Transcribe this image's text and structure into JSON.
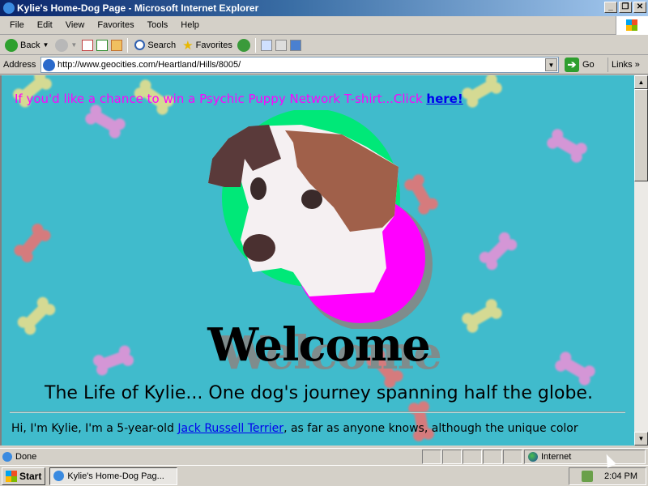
{
  "window": {
    "title": "Kylie's Home-Dog Page - Microsoft Internet Explorer",
    "buttons": [
      "_",
      "❐",
      "✕"
    ]
  },
  "menu": [
    "File",
    "Edit",
    "View",
    "Favorites",
    "Tools",
    "Help"
  ],
  "toolbar": {
    "back": "Back",
    "search": "Search",
    "favorites": "Favorites"
  },
  "address": {
    "label": "Address",
    "url": "http://www.geocities.com/Heartland/Hills/8005/",
    "go": "Go",
    "links": "Links"
  },
  "page": {
    "promo_text": "If you'd like a chance to win a Psychic Puppy Network T-shirt...Click ",
    "promo_link": "here!",
    "welcome": "Welcome",
    "subtitle": "The Life of Kylie... One dog's journey spanning half the globe.",
    "intro_start": "Hi, I'm Kylie, I'm a 5-year-old ",
    "intro_link": "Jack Russell Terrier",
    "intro_end": ", as far as anyone knows, although the unique color",
    "colors": {
      "background": "#40bbcc",
      "promo": "#ff00ff",
      "link": "#0000ee"
    }
  },
  "status": {
    "text": "Done",
    "zone": "Internet"
  },
  "taskbar": {
    "start": "Start",
    "task": "Kylie's Home-Dog Pag...",
    "clock": "2:04 PM"
  }
}
